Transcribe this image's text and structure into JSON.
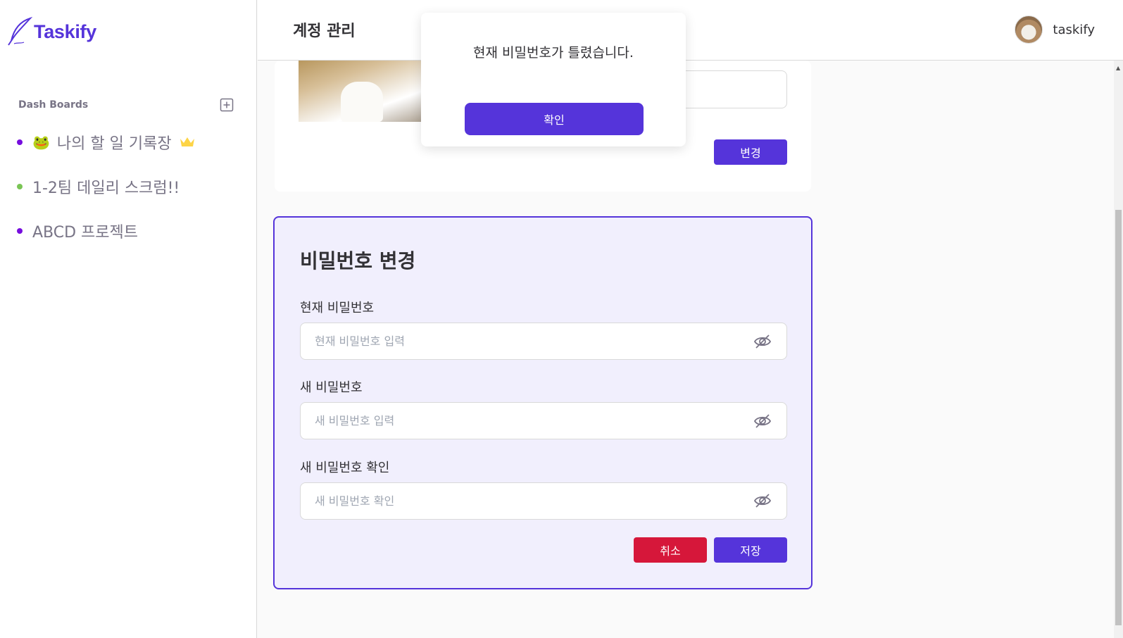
{
  "brand": {
    "name": "Taskify",
    "accent": "#5534da"
  },
  "sidebar": {
    "section_title": "Dash Boards",
    "items": [
      {
        "emoji": "🐸",
        "label": "나의 할 일 기록장",
        "dot_color": "#7ac555",
        "dot_color_actual": "#760dde",
        "owner": true
      },
      {
        "label": "1-2팀 데일리 스크럼!!",
        "dot_color": "#7ac555"
      },
      {
        "label": "ABCD 프로젝트",
        "dot_color": "#760dde"
      }
    ]
  },
  "header": {
    "title": "계정 관리",
    "username": "taskify"
  },
  "profile_card": {
    "change_label": "변경"
  },
  "password_card": {
    "title": "비밀번호 변경",
    "current": {
      "label": "현재 비밀번호",
      "placeholder": "현재 비밀번호 입력"
    },
    "new": {
      "label": "새 비밀번호",
      "placeholder": "새 비밀번호 입력"
    },
    "confirm": {
      "label": "새 비밀번호 확인",
      "placeholder": "새 비밀번호 확인"
    },
    "cancel_label": "취소",
    "save_label": "저장"
  },
  "modal": {
    "message": "현재 비밀번호가 틀렸습니다.",
    "confirm_label": "확인"
  }
}
